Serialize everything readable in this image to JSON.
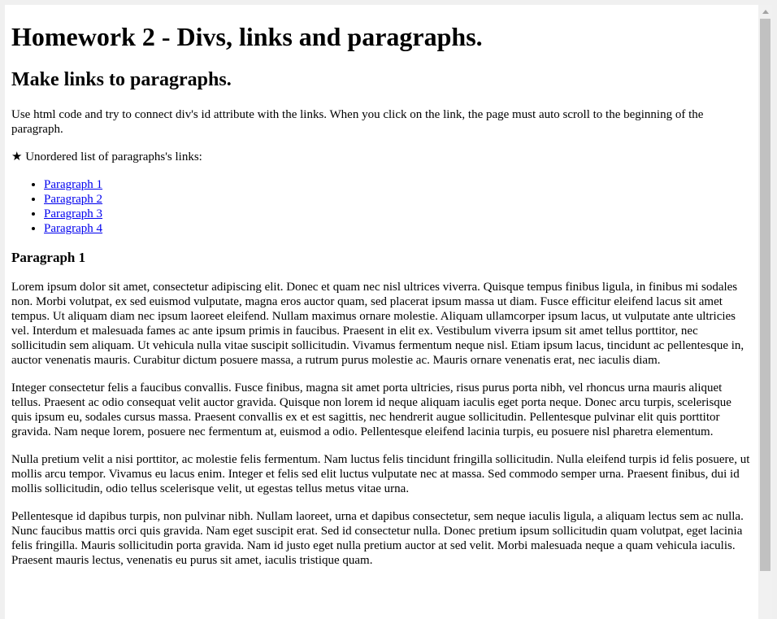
{
  "page": {
    "title": "Homework 2 - Divs, links and paragraphs.",
    "subtitle": "Make links to paragraphs.",
    "instructions": "Use html code and try to connect div's id attribute with the links. When you click on the link, the page must auto scroll to the beginning of the paragraph.",
    "list_intro": "★ Unordered list of paragraphs's links:"
  },
  "links": [
    {
      "label": "Paragraph 1"
    },
    {
      "label": "Paragraph 2"
    },
    {
      "label": "Paragraph 3"
    },
    {
      "label": "Paragraph 4"
    }
  ],
  "sections": [
    {
      "heading": "Paragraph 1",
      "paragraphs": [
        "Lorem ipsum dolor sit amet, consectetur adipiscing elit. Donec et quam nec nisl ultrices viverra. Quisque tempus finibus ligula, in finibus mi sodales non. Morbi volutpat, ex sed euismod vulputate, magna eros auctor quam, sed placerat ipsum massa ut diam. Fusce efficitur eleifend lacus sit amet tempus. Ut aliquam diam nec ipsum laoreet eleifend. Nullam maximus ornare molestie. Aliquam ullamcorper ipsum lacus, ut vulputate ante ultricies vel. Interdum et malesuada fames ac ante ipsum primis in faucibus. Praesent in elit ex. Vestibulum viverra ipsum sit amet tellus porttitor, nec sollicitudin sem aliquam. Ut vehicula nulla vitae suscipit sollicitudin. Vivamus fermentum neque nisl. Etiam ipsum lacus, tincidunt ac pellentesque in, auctor venenatis mauris. Curabitur dictum posuere massa, a rutrum purus molestie ac. Mauris ornare venenatis erat, nec iaculis diam.",
        "Integer consectetur felis a faucibus convallis. Fusce finibus, magna sit amet porta ultricies, risus purus porta nibh, vel rhoncus urna mauris aliquet tellus. Praesent ac odio consequat velit auctor gravida. Quisque non lorem id neque aliquam iaculis eget porta neque. Donec arcu turpis, scelerisque quis ipsum eu, sodales cursus massa. Praesent convallis ex et est sagittis, nec hendrerit augue sollicitudin. Pellentesque pulvinar elit quis porttitor gravida. Nam neque lorem, posuere nec fermentum at, euismod a odio. Pellentesque eleifend lacinia turpis, eu posuere nisl pharetra elementum.",
        "Nulla pretium velit a nisi porttitor, ac molestie felis fermentum. Nam luctus felis tincidunt fringilla sollicitudin. Nulla eleifend turpis id felis posuere, ut mollis arcu tempor. Vivamus eu lacus enim. Integer et felis sed elit luctus vulputate nec at massa. Sed commodo semper urna. Praesent finibus, dui id mollis sollicitudin, odio tellus scelerisque velit, ut egestas tellus metus vitae urna.",
        "Pellentesque id dapibus turpis, non pulvinar nibh. Nullam laoreet, urna et dapibus consectetur, sem neque iaculis ligula, a aliquam lectus sem ac nulla. Nunc faucibus mattis orci quis gravida. Nam eget suscipit erat. Sed id consectetur nulla. Donec pretium ipsum sollicitudin quam volutpat, eget lacinia felis fringilla. Mauris sollicitudin porta gravida. Nam id justo eget nulla pretium auctor at sed velit. Morbi malesuada neque a quam vehicula iaculis. Praesent mauris lectus, venenatis eu purus sit amet, iaculis tristique quam."
      ]
    }
  ],
  "colors": {
    "link": "#0000ee",
    "text": "#000000",
    "background": "#ffffff",
    "scrollbar_track": "#f1f1f1",
    "scrollbar_thumb": "#c1c1c1"
  },
  "icons": {
    "scroll_up": "scroll-up-arrow-icon"
  },
  "scroll": {
    "thumb_fraction": 0.92
  }
}
